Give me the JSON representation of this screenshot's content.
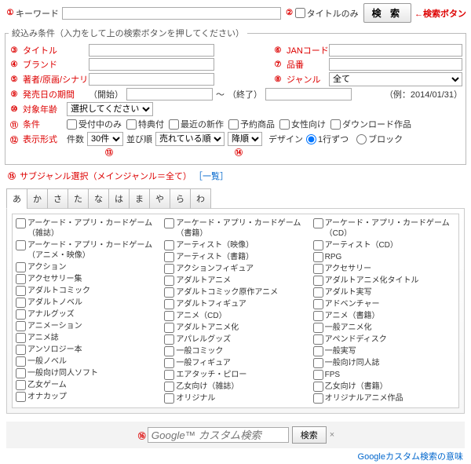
{
  "m": {
    "1": "①",
    "2": "②",
    "3": "③",
    "4": "④",
    "5": "⑤",
    "6": "⑥",
    "7": "⑦",
    "8": "⑧",
    "9": "⑨",
    "10": "⑩",
    "11": "⑪",
    "12": "⑫",
    "13": "⑬",
    "14": "⑭",
    "15": "⑮",
    "16": "⑯"
  },
  "top": {
    "keyword_label": "キーワード",
    "title_only": "タイトルのみ",
    "search_btn": "検 索",
    "search_note": "←検索ボタン"
  },
  "fs": {
    "legend": "絞込み条件（入力をして上の検索ボタンを押してください）",
    "title": "タイトル",
    "jan": "JANコード",
    "brand": "ブランド",
    "hinban": "品番",
    "author": "著者/原画/シナリオ",
    "genre": "ジャンル",
    "genre_val": "全て",
    "release": "発売日の期間",
    "start": "（開始）",
    "end": "（終了）",
    "tilde": "～",
    "example": "（例：2014/01/31）",
    "age": "対象年齢",
    "age_val": "選択してください",
    "cond": "条件",
    "cb": [
      "受付中のみ",
      "特典付",
      "最近の新作",
      "予約商品",
      "女性向け",
      "ダウンロード作品"
    ],
    "disp": "表示形式",
    "count_lbl": "件数",
    "count_val": "30件",
    "sort_lbl": "並び順",
    "sort1_val": "売れている順",
    "sort2_val": "降順",
    "design": "デザイン",
    "design_opts": [
      "1行ずつ",
      "ブロック"
    ]
  },
  "sub": {
    "label": "サブジャンル選択（メインジャンル＝全て）",
    "list_link": "［一覧］"
  },
  "tabs": [
    "あ",
    "か",
    "さ",
    "た",
    "な",
    "は",
    "ま",
    "や",
    "ら",
    "わ"
  ],
  "cats": {
    "c1": [
      "アーケード・アプリ・カードゲーム（雑誌）",
      "アーケード・アプリ・カードゲーム（アニメ・映像）",
      "アクション",
      "アクセサリー集",
      "アダルトコミック",
      "アダルトノベル",
      "アナルグッズ",
      "アニメーション",
      "アニメ誌",
      "アンソロジー本",
      "一般ノベル",
      "一般向け同人ソフト",
      "乙女ゲーム",
      "オナカップ"
    ],
    "c2": [
      "アーケード・アプリ・カードゲーム（書籍）",
      "アーティスト（映像）",
      "アーティスト（書籍）",
      "アクションフィギュア",
      "アダルトアニメ",
      "アダルトコミック原作アニメ",
      "アダルトフィギュア",
      "アニメ（CD）",
      "アダルトアニメ化",
      "アパレルグッズ",
      "一般コミック",
      "一般フィギュア",
      "エアタッチ・ピロー",
      "乙女向け（雑誌）",
      "オリジナル"
    ],
    "c3": [
      "アーケード・アプリ・カードゲーム（CD）",
      "アーティスト（CD）",
      "RPG",
      "アクセサリー",
      "アダルトアニメ化タイトル",
      "アダルト実写",
      "アドベンチャー",
      "アニメ（書籍）",
      "一般アニメ化",
      "アペンドディスク",
      "一般実写",
      "一般向け同人誌",
      "FPS",
      "乙女向け（書籍）",
      "オリジナルアニメ作品"
    ]
  },
  "google": {
    "placeholder": "Google™ カスタム検索",
    "btn": "検索",
    "x": "×",
    "link": "Googleカスタム検索の意味"
  }
}
